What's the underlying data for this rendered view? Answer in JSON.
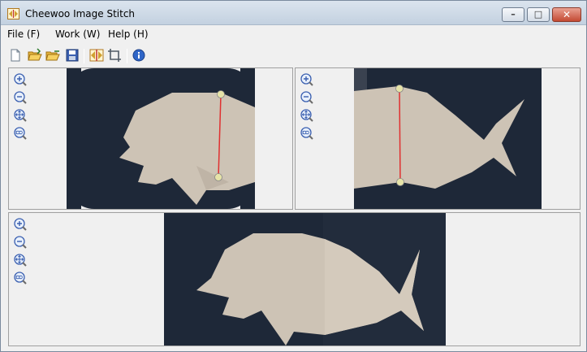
{
  "window": {
    "title": "Cheewoo Image Stitch",
    "controls": {
      "minimize": "–",
      "maximize": "□",
      "close": "✕"
    }
  },
  "menu": {
    "items": [
      {
        "label": "File (F)"
      },
      {
        "label": "Work (W)"
      },
      {
        "label": "Help (H)"
      }
    ]
  },
  "toolbar": {
    "buttons": [
      "new-icon",
      "open-first-icon",
      "open-second-icon",
      "save-icon",
      "stitch-icon",
      "crop-icon",
      "info-icon"
    ]
  },
  "zoom_controls": [
    "zoom-in-icon",
    "zoom-out-icon",
    "zoom-fit-icon",
    "zoom-100-icon"
  ],
  "colors": {
    "background": "#1e2838",
    "paper_fish": "#cdc3b5",
    "match_line": "#e03030",
    "match_point": "#e6e3a8",
    "titlebar": "#c9d6e4"
  }
}
